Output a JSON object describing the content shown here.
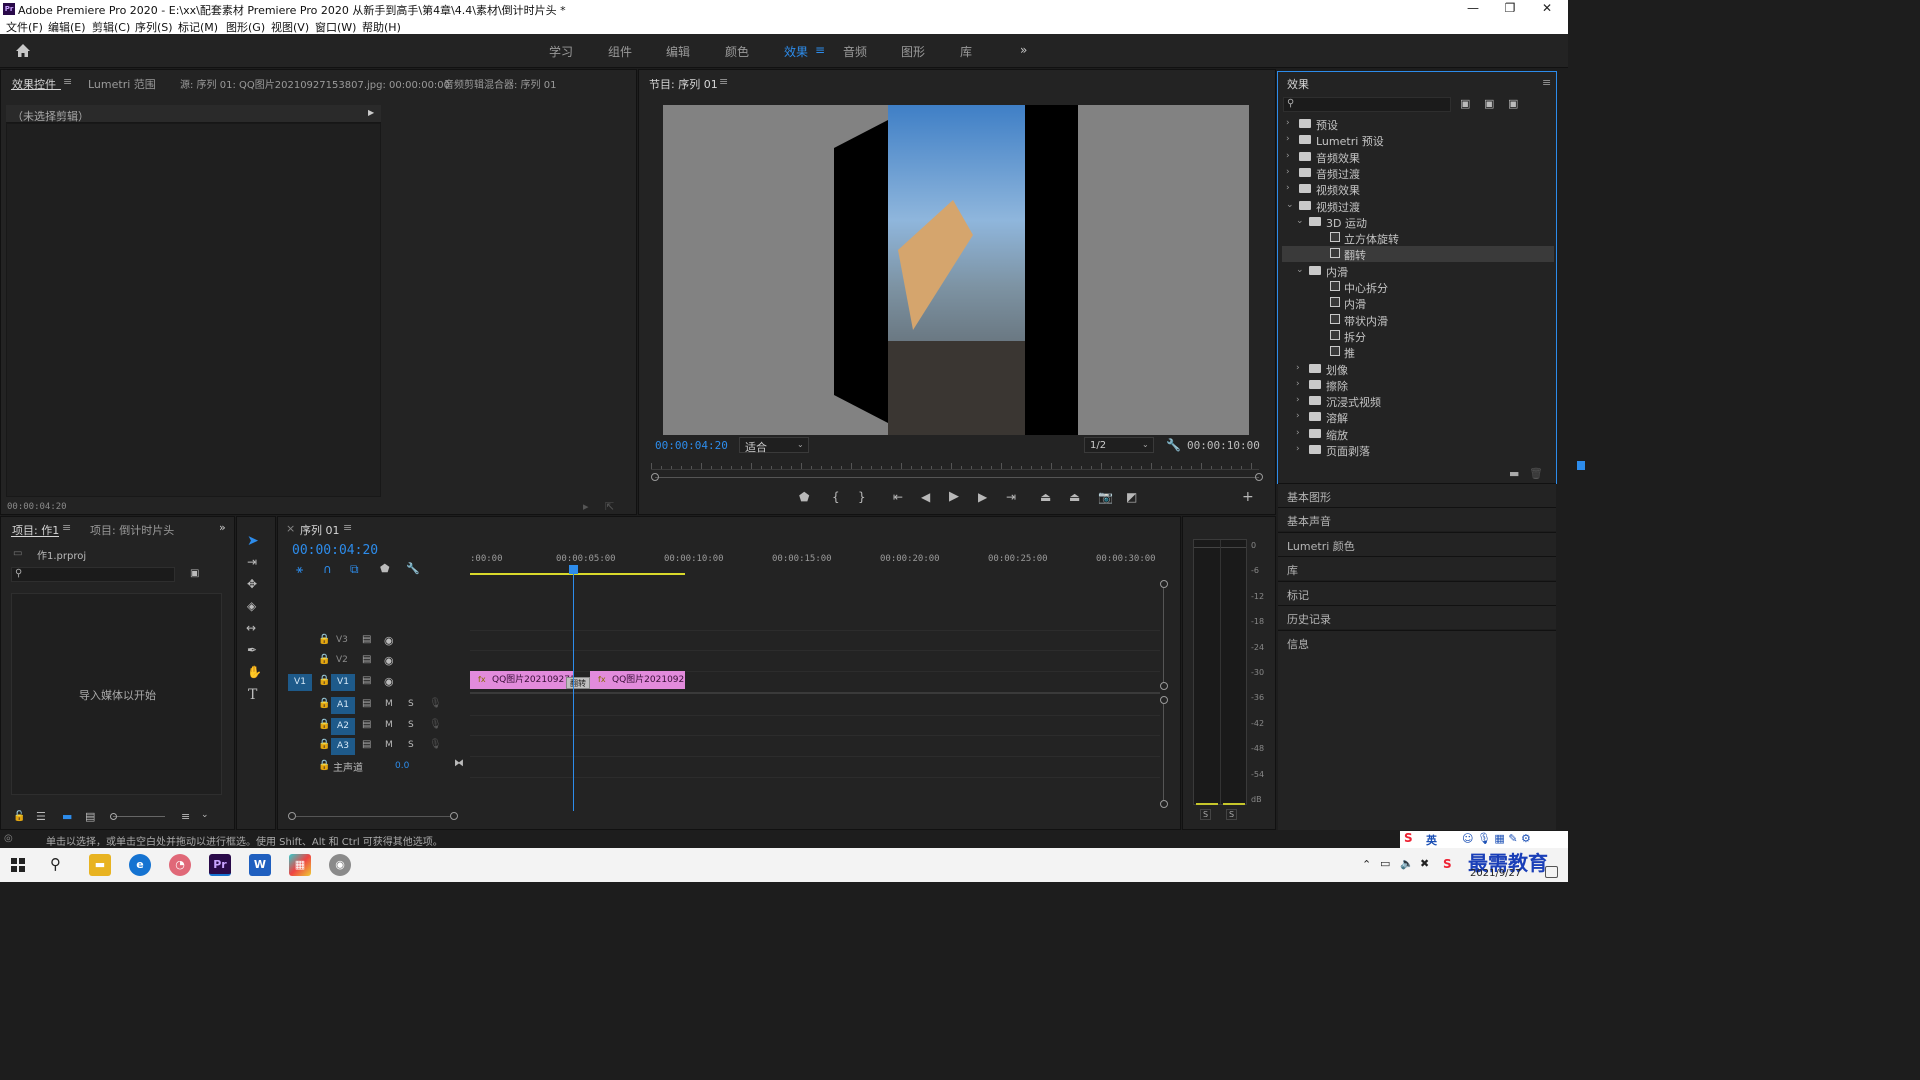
{
  "window": {
    "title": "Adobe Premiere Pro 2020 - E:\\xx\\配套素材 Premiere Pro 2020 从新手到高手\\第4章\\4.4\\素材\\倒计时片头 *",
    "app_icon": "Pr"
  },
  "menu": [
    "文件(F)",
    "编辑(E)",
    "剪辑(C)",
    "序列(S)",
    "标记(M)",
    "图形(G)",
    "视图(V)",
    "窗口(W)",
    "帮助(H)"
  ],
  "workspaces": {
    "items": [
      "学习",
      "组件",
      "编辑",
      "颜色",
      "效果",
      "音频",
      "图形",
      "库"
    ],
    "active": "效果",
    "more_icon": "»"
  },
  "source_panel": {
    "tabs": [
      "效果控件",
      "Lumetri 范围",
      "源: 序列 01: QQ图片20210927153807.jpg: 00:00:00:00",
      "音频剪辑混合器: 序列 01"
    ],
    "no_clip": "（未选择剪辑）",
    "timecode": "00:00:04:20"
  },
  "program_monitor": {
    "title": "节目: 序列 01",
    "timecode": "00:00:04:20",
    "fit": "适合",
    "resolution": "1/2",
    "duration": "00:00:10:00",
    "playhead_fraction": 0.48
  },
  "effects_panel": {
    "title": "效果",
    "tree": [
      {
        "label": "预设",
        "level": 0,
        "type": "folder",
        "state": "closed",
        "variant": "preset"
      },
      {
        "label": "Lumetri 预设",
        "level": 0,
        "type": "folder",
        "state": "closed",
        "variant": "preset"
      },
      {
        "label": "音频效果",
        "level": 0,
        "type": "folder",
        "state": "closed"
      },
      {
        "label": "音频过渡",
        "level": 0,
        "type": "folder",
        "state": "closed"
      },
      {
        "label": "视频效果",
        "level": 0,
        "type": "folder",
        "state": "closed"
      },
      {
        "label": "视频过渡",
        "level": 0,
        "type": "folder",
        "state": "open"
      },
      {
        "label": "3D 运动",
        "level": 1,
        "type": "folder",
        "state": "open"
      },
      {
        "label": "立方体旋转",
        "level": 2,
        "type": "effect"
      },
      {
        "label": "翻转",
        "level": 2,
        "type": "effect",
        "selected": true
      },
      {
        "label": "内滑",
        "level": 1,
        "type": "folder",
        "state": "open"
      },
      {
        "label": "中心拆分",
        "level": 2,
        "type": "effect"
      },
      {
        "label": "内滑",
        "level": 2,
        "type": "effect"
      },
      {
        "label": "带状内滑",
        "level": 2,
        "type": "effect"
      },
      {
        "label": "拆分",
        "level": 2,
        "type": "effect"
      },
      {
        "label": "推",
        "level": 2,
        "type": "effect"
      },
      {
        "label": "划像",
        "level": 1,
        "type": "folder",
        "state": "closed"
      },
      {
        "label": "擦除",
        "level": 1,
        "type": "folder",
        "state": "closed"
      },
      {
        "label": "沉浸式视频",
        "level": 1,
        "type": "folder",
        "state": "closed"
      },
      {
        "label": "溶解",
        "level": 1,
        "type": "folder",
        "state": "closed"
      },
      {
        "label": "缩放",
        "level": 1,
        "type": "folder",
        "state": "closed"
      },
      {
        "label": "页面剥落",
        "level": 1,
        "type": "folder",
        "state": "closed"
      }
    ]
  },
  "side_panels": [
    "基本图形",
    "基本声音",
    "Lumetri 颜色",
    "库",
    "标记",
    "历史记录",
    "信息"
  ],
  "project_panel": {
    "tabs": [
      "项目: 作1",
      "项目: 倒计时片头"
    ],
    "file": "作1.prproj",
    "import_hint": "导入媒体以开始"
  },
  "timeline": {
    "tab": "序列 01",
    "timecode": "00:00:04:20",
    "ruler": [
      ":00:00",
      "00:00:05:00",
      "00:00:10:00",
      "00:00:15:00",
      "00:00:20:00",
      "00:00:25:00",
      "00:00:30:00"
    ],
    "video_tracks": [
      {
        "name": "V3",
        "active": false
      },
      {
        "name": "V2",
        "active": false
      },
      {
        "name": "V1",
        "active": true,
        "source": "V1"
      }
    ],
    "audio_tracks": [
      "A1",
      "A2",
      "A3"
    ],
    "track_buttons": {
      "mute": "M",
      "solo": "S"
    },
    "master": {
      "label": "主声道",
      "value": "0.0"
    },
    "clips": [
      {
        "label": "QQ图片2021092715",
        "fx": "fx"
      },
      {
        "label": "QQ图片2021092715",
        "fx": "fx"
      }
    ],
    "transition_label": "翻转"
  },
  "audio_meter": {
    "scale": [
      "0",
      "-6",
      "-12",
      "-18",
      "-24",
      "-30",
      "-36",
      "-42",
      "-48",
      "-54",
      "dB"
    ],
    "solo_buttons": [
      "S",
      "S"
    ]
  },
  "status_bar": "单击以选择，或单击空白处并拖动以进行框选。使用 Shift、Alt 和 Ctrl 可获得其他选项。",
  "taskbar": {
    "ime": "英",
    "date": "2021/9/27",
    "watermark": "最需教育"
  },
  "colors": {
    "accent": "#2d8ceb",
    "clip": "#e28bdc",
    "panel": "#232323"
  }
}
